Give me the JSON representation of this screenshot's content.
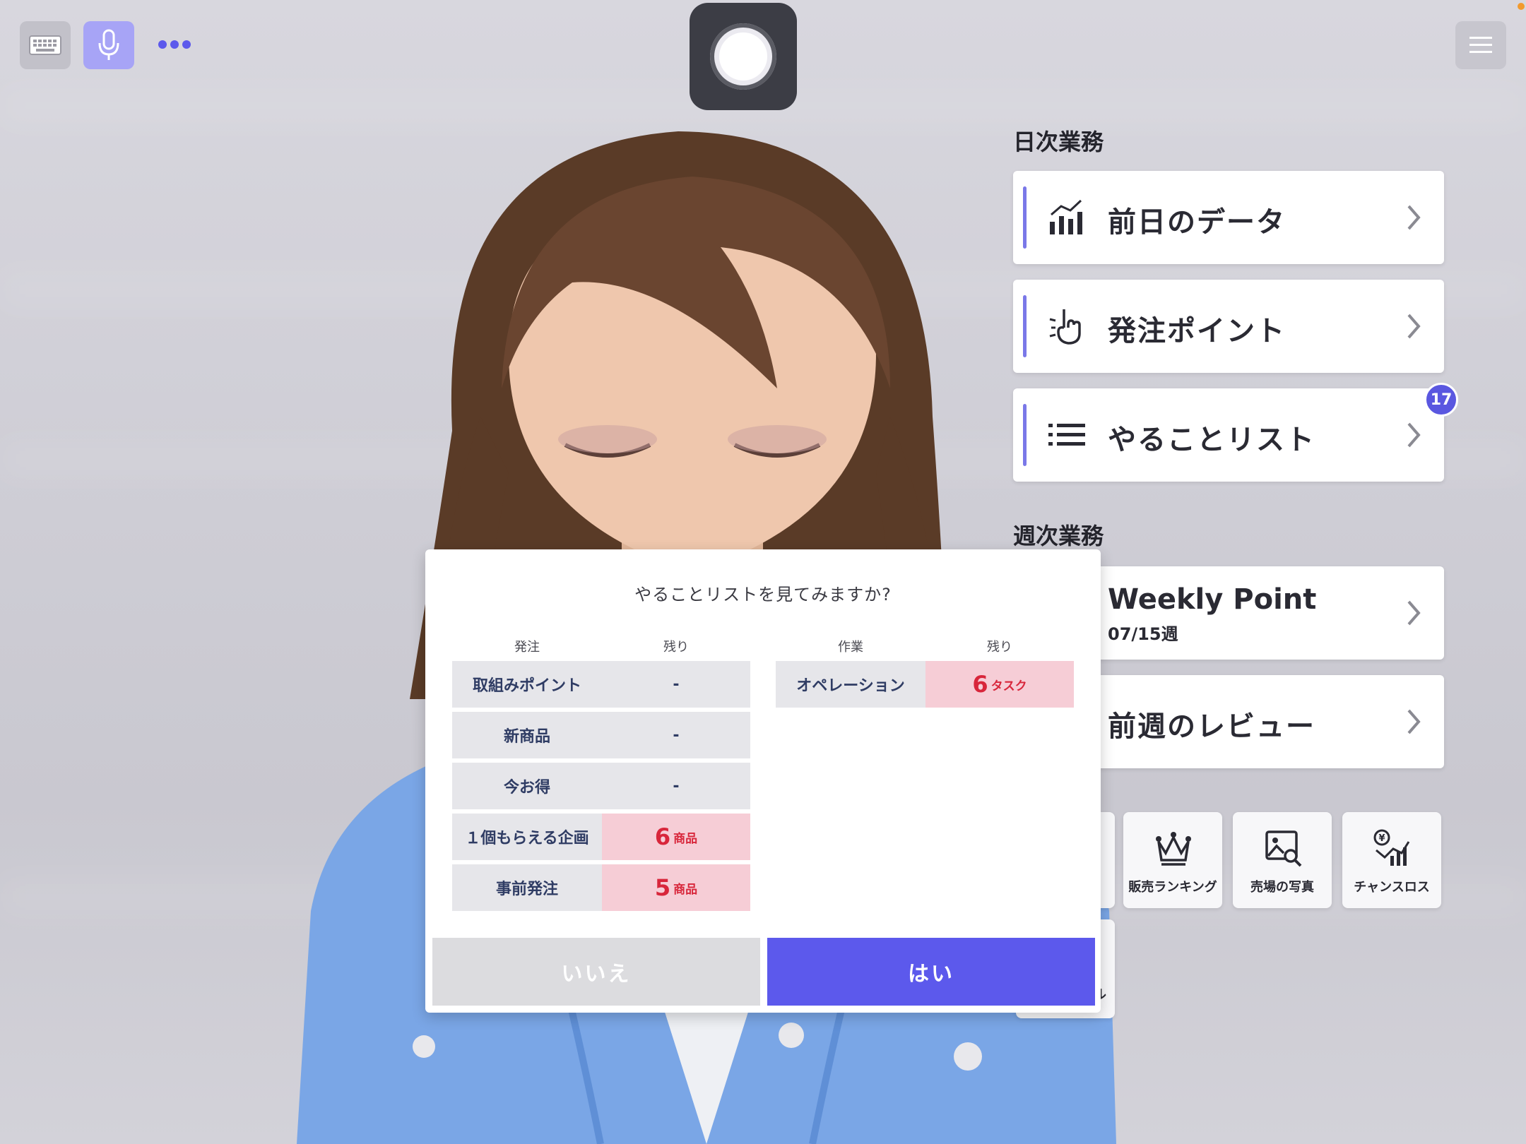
{
  "topbar": {
    "keyboard_icon": "keyboard-icon",
    "mic_icon": "microphone-icon",
    "more_icon": "more-dots-icon",
    "record_icon": "record-button-icon",
    "menu_icon": "hamburger-menu-icon"
  },
  "daily": {
    "title": "日次業務",
    "items": [
      {
        "label": "前日のデータ",
        "icon": "bar-chart-icon"
      },
      {
        "label": "発注ポイント",
        "icon": "pointing-hand-icon"
      },
      {
        "label": "やることリスト",
        "icon": "list-icon",
        "badge": "17"
      }
    ]
  },
  "weekly": {
    "title": "週次業務",
    "items": [
      {
        "label": "Weekly Point",
        "sub": "07/15週"
      },
      {
        "label": "前週のレビュー"
      }
    ]
  },
  "tiles": [
    {
      "label": "販売ランキング",
      "icon": "crown-icon"
    },
    {
      "label": "売場の写真",
      "icon": "photo-search-icon"
    },
    {
      "label": "チャンスロス",
      "icon": "yen-chart-icon"
    }
  ],
  "partial_tile_label": "ル",
  "dialog": {
    "question": "やることリストを見てみますか?",
    "left_headers": [
      "発注",
      "残り"
    ],
    "right_headers": [
      "作業",
      "残り"
    ],
    "left_rows": [
      {
        "name": "取組みポイント",
        "value": "-",
        "highlight": false
      },
      {
        "name": "新商品",
        "value": "-",
        "highlight": false
      },
      {
        "name": "今お得",
        "value": "-",
        "highlight": false
      },
      {
        "name": "１個もらえる企画",
        "value": "6",
        "unit": "商品",
        "highlight": true
      },
      {
        "name": "事前発注",
        "value": "5",
        "unit": "商品",
        "highlight": true
      }
    ],
    "right_rows": [
      {
        "name": "オペレーション",
        "value": "6",
        "unit": "タスク",
        "highlight": true
      }
    ],
    "no_label": "いいえ",
    "yes_label": "はい"
  },
  "colors": {
    "accent": "#5c59ec",
    "card_bar": "#7a78e8",
    "badge": "#5a57e0",
    "highlight_bg": "#f6cdd6",
    "highlight_text": "#d8263b"
  }
}
